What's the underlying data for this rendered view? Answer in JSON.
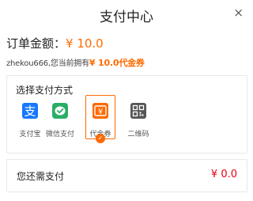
{
  "header": {
    "title": "支付中心",
    "close_symbol": "×"
  },
  "order": {
    "label": "订单金额：",
    "amount": "¥ 10.0"
  },
  "coupon": {
    "prefix": "zhekou666,您当前拥有",
    "value": "¥ 10.0代金券"
  },
  "payment": {
    "label": "选择支付方式",
    "selected": "代金券",
    "methods": [
      {
        "name": "支付宝",
        "icon": "alipay-icon",
        "color": "#1677ff"
      },
      {
        "name": "微信支付",
        "icon": "wechat-pay-icon",
        "color": "#2aae67"
      },
      {
        "name": "代金券",
        "icon": "voucher-icon",
        "color": "#ff6a00"
      },
      {
        "name": "二维码",
        "icon": "qrcode-icon",
        "color": "#555555"
      }
    ]
  },
  "remaining": {
    "label": "您还需支付",
    "amount": "¥ 0.0"
  },
  "colors": {
    "accent": "#ff6a00",
    "price_red": "#e60012"
  }
}
